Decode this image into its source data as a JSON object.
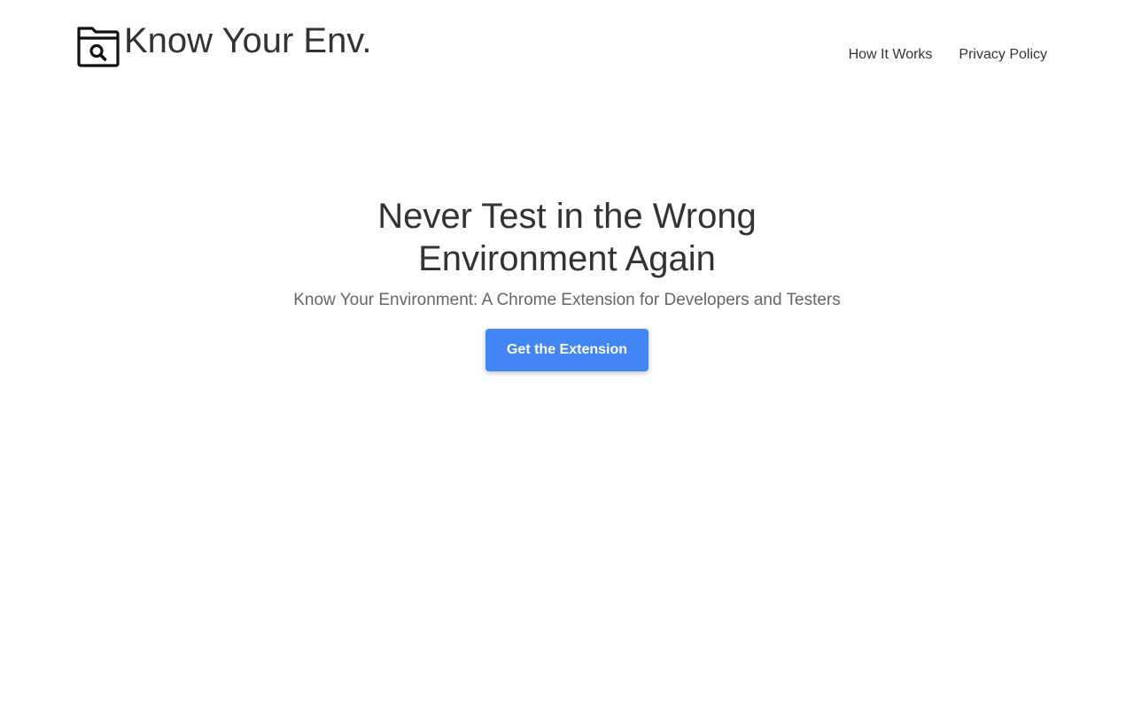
{
  "header": {
    "brand": {
      "name": "Know Your Env.",
      "logo_icon": "folder-search-icon"
    },
    "nav": {
      "items": [
        {
          "label": "How It Works"
        },
        {
          "label": "Privacy Policy"
        }
      ]
    }
  },
  "hero": {
    "title": "Never Test in the Wrong Environment Again",
    "subtitle": "Know Your Environment: A Chrome Extension for Developers and Testers",
    "cta_label": "Get the Extension"
  },
  "colors": {
    "accent": "#4285f4",
    "text": "#333333",
    "muted": "#666666",
    "background": "#ffffff"
  }
}
